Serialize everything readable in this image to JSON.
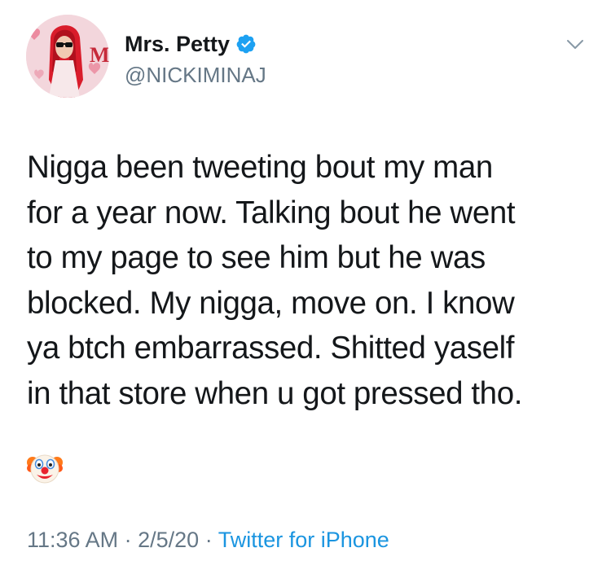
{
  "tweet": {
    "display_name": "Mrs. Petty",
    "handle": "@NICKIMINAJ",
    "verified": true,
    "text_lines": [
      "Nigga been tweeting bout my man",
      "for a year now. Talking bout he went",
      "to my page to see him but he was",
      "blocked. My nigga, move on. I know",
      "ya btch embarrassed. Shitted yaself",
      "in that store when u got pressed tho."
    ],
    "emoji": "clown-face",
    "time": "11:36 AM",
    "separator": "·",
    "date": "2/5/20",
    "source": "Twitter for iPhone"
  },
  "icons": {
    "verified": "verified-badge-icon",
    "menu": "chevron-down-icon",
    "avatar": "profile-photo"
  },
  "colors": {
    "verified_blue": "#1da1f2",
    "link_blue": "#1b95e0",
    "secondary_text": "#657786",
    "primary_text": "#14171a"
  }
}
